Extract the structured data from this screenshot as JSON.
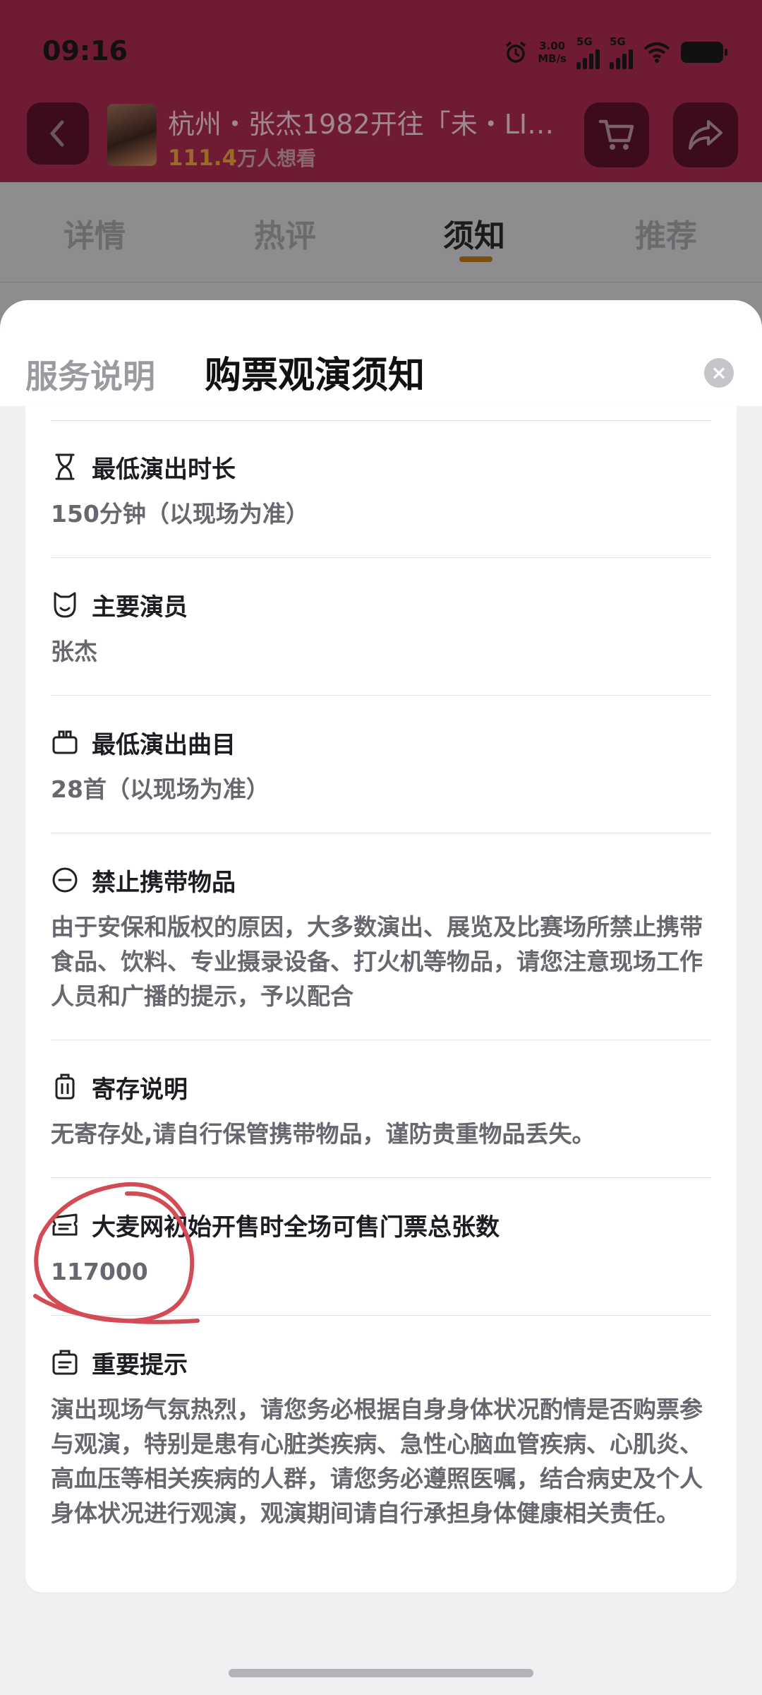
{
  "status_bar": {
    "time": "09:16",
    "speed_value": "3.00",
    "speed_unit": "MB/s",
    "sim1": "5G",
    "sim2": "5G",
    "battery": "100"
  },
  "header": {
    "title": "杭州・张杰1982开往「未・LI…",
    "want_count": "111.4",
    "want_suffix": "万人想看"
  },
  "tabs": [
    {
      "label": "详情"
    },
    {
      "label": "热评"
    },
    {
      "label": "须知"
    },
    {
      "label": "推荐"
    }
  ],
  "sheet": {
    "tab_service": "服务说明",
    "tab_notice": "购票观演须知",
    "close": "×"
  },
  "items": [
    {
      "icon": "hourglass-icon",
      "title": "最低演出时长",
      "body": "150分钟（以现场为准）"
    },
    {
      "icon": "mask-icon",
      "title": "主要演员",
      "body": "张杰"
    },
    {
      "icon": "album-icon",
      "title": "最低演出曲目",
      "body": "28首（以现场为准）"
    },
    {
      "icon": "forbidden-icon",
      "title": "禁止携带物品",
      "body": "由于安保和版权的原因，大多数演出、展览及比赛场所禁止携带食品、饮料、专业摄录设备、打火机等物品，请您注意现场工作人员和广播的提示，予以配合"
    },
    {
      "icon": "luggage-icon",
      "title": "寄存说明",
      "body": "无寄存处,请自行保管携带物品，谨防贵重物品丢失。"
    },
    {
      "icon": "ticket-icon",
      "title": "大麦网初始开售时全场可售门票总张数",
      "body": "117000"
    },
    {
      "icon": "notice-board-icon",
      "title": "重要提示",
      "body": "演出现场气氛热烈，请您务必根据自身身体状况酌情是否购票参与观演，特别是患有心脏类疾病、急性心脑血管疾病、心肌炎、高血压等相关疾病的人群，请您务必遵照医嘱，结合病史及个人身体状况进行观演，观演期间请自行承担身体健康相关责任。"
    }
  ],
  "colors": {
    "header_bg": "#6e1b33",
    "accent_underline": "#7b4f10",
    "annotation_red": "#d24b55"
  }
}
